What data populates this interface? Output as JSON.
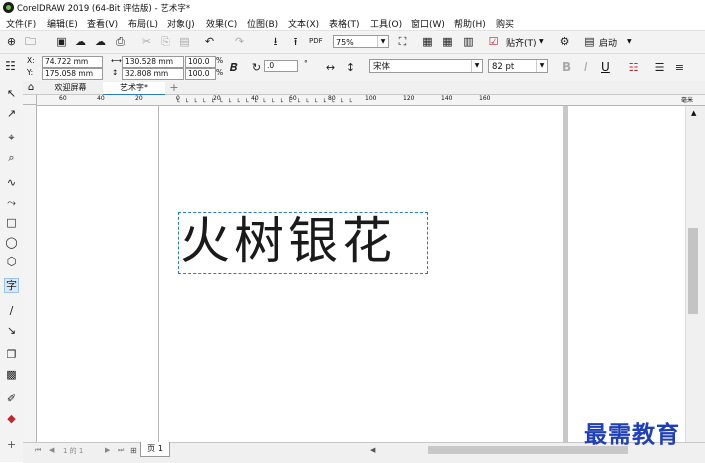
{
  "window": {
    "title": "CorelDRAW 2019 (64-Bit 评估版) - 艺术字*"
  },
  "menu": [
    {
      "label": "文件(F)"
    },
    {
      "label": "编辑(E)"
    },
    {
      "label": "查看(V)"
    },
    {
      "label": "布局(L)"
    },
    {
      "label": "对象(J)"
    },
    {
      "label": "效果(C)"
    },
    {
      "label": "位图(B)"
    },
    {
      "label": "文本(X)"
    },
    {
      "label": "表格(T)"
    },
    {
      "label": "工具(O)"
    },
    {
      "label": "窗口(W)"
    },
    {
      "label": "帮助(H)"
    },
    {
      "label": "购买"
    }
  ],
  "toolbar": {
    "zoom": "75%",
    "snap_label": "贴齐(T)",
    "launch_label": "启动"
  },
  "properties": {
    "x_label": "X:",
    "y_label": "Y:",
    "x": "74.722 mm",
    "y": "175.058 mm",
    "width": "130.528 mm",
    "height": "32.808 mm",
    "scale_x": "100.0",
    "scale_y": "100.0",
    "percent": "%",
    "rotation": ".0",
    "degree": "°",
    "font": "宋体",
    "font_size": "82 pt",
    "bold": "B",
    "italic": "I",
    "underline": "U"
  },
  "tabs": {
    "welcome": "欢迎屏幕",
    "document": "艺术字*",
    "add": "+"
  },
  "ruler": {
    "ticks": [
      "60",
      "40",
      "20",
      "0",
      "20",
      "40",
      "60",
      "80",
      "100",
      "120",
      "140",
      "160"
    ],
    "unit": "毫米"
  },
  "canvas": {
    "art_text": "火树银花"
  },
  "status": {
    "page_info": "1 的 1",
    "page_tab": "页 1"
  },
  "watermark": "最需教育"
}
